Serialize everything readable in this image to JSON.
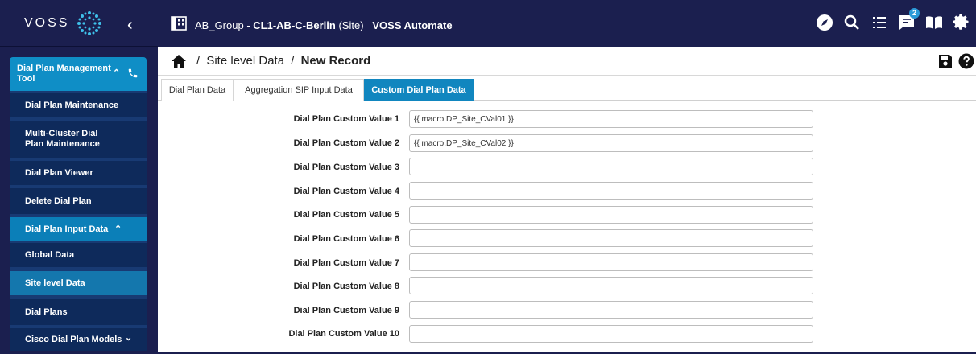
{
  "brand": {
    "logo_text": "VOSS"
  },
  "header": {
    "group": "AB_Group -",
    "site_name": "CL1-AB-C-Berlin",
    "site_type": "(Site)",
    "app_name": "VOSS Automate",
    "icons": [
      "compass-icon",
      "search-icon",
      "list-icon",
      "chat-icon",
      "book-icon",
      "gear-icon"
    ],
    "chat_badge": "2"
  },
  "sidebar": {
    "menu_title": "Dial Plan Management Tool",
    "items": [
      {
        "label": "Dial Plan Maintenance"
      },
      {
        "label": "Multi-Cluster Dial Plan Maintenance"
      },
      {
        "label": "Dial Plan Viewer"
      },
      {
        "label": "Delete Dial Plan"
      },
      {
        "label": "Dial Plan Input Data"
      },
      {
        "label": "Global Data"
      },
      {
        "label": "Site level Data"
      },
      {
        "label": "Dial Plans"
      },
      {
        "label": "Cisco Dial Plan Models"
      }
    ]
  },
  "breadcrumb": {
    "parent": "Site level Data",
    "sep1": "/",
    "sep2": "/",
    "current": "New Record"
  },
  "tabs": [
    {
      "label": "Dial Plan Data"
    },
    {
      "label": "Aggregation SIP Input Data"
    },
    {
      "label": "Custom Dial Plan Data"
    }
  ],
  "form": {
    "fields": [
      {
        "label": "Dial Plan Custom Value 1",
        "value": "{{ macro.DP_Site_CVal01 }}"
      },
      {
        "label": "Dial Plan Custom Value 2",
        "value": "{{ macro.DP_Site_CVal02 }}"
      },
      {
        "label": "Dial Plan Custom Value 3",
        "value": ""
      },
      {
        "label": "Dial Plan Custom Value 4",
        "value": ""
      },
      {
        "label": "Dial Plan Custom Value 5",
        "value": ""
      },
      {
        "label": "Dial Plan Custom Value 6",
        "value": ""
      },
      {
        "label": "Dial Plan Custom Value 7",
        "value": ""
      },
      {
        "label": "Dial Plan Custom Value 8",
        "value": ""
      },
      {
        "label": "Dial Plan Custom Value 9",
        "value": ""
      },
      {
        "label": "Dial Plan Custom Value 10",
        "value": ""
      }
    ]
  },
  "colors": {
    "nav_bg": "#1b1f4f",
    "accent": "#1186bf"
  }
}
